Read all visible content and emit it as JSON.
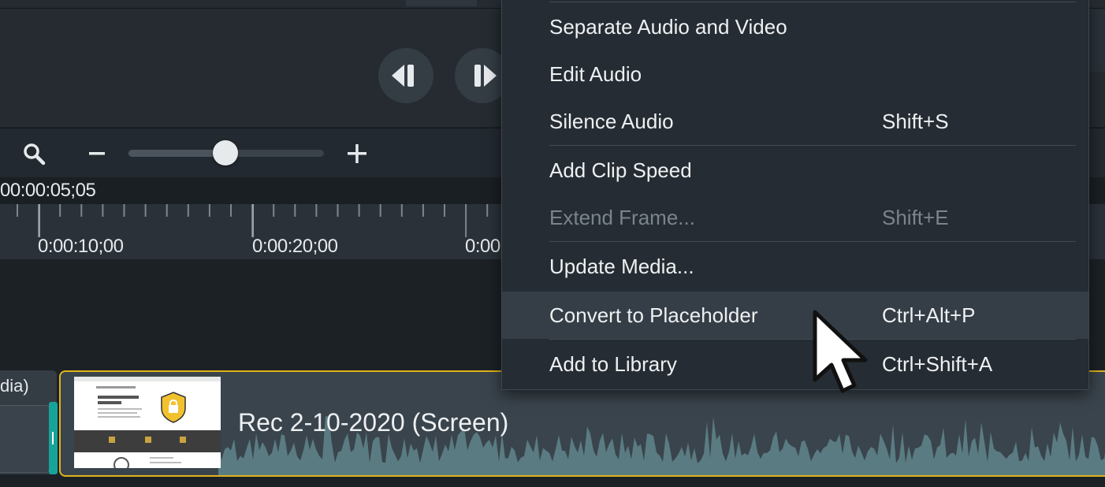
{
  "playhead": {
    "time": "00:00:05;05"
  },
  "ruler": {
    "labels": [
      "0:00:10;00",
      "0:00:20;00",
      "0:00"
    ]
  },
  "zoom": {
    "minus_symbol": "−",
    "plus_symbol": "+",
    "level": 0.5
  },
  "tracks": {
    "left_clip_label": "dia)",
    "main_clip_title": "Rec 2-10-2020 (Screen)"
  },
  "context_menu": {
    "items": [
      {
        "label": "Separate Audio and Video",
        "shortcut": "",
        "enabled": true,
        "highlighted": false
      },
      {
        "label": "Edit Audio",
        "shortcut": "",
        "enabled": true,
        "highlighted": false
      },
      {
        "label": "Silence Audio",
        "shortcut": "Shift+S",
        "enabled": true,
        "highlighted": false
      },
      {
        "label": "Add Clip Speed",
        "shortcut": "",
        "enabled": true,
        "highlighted": false
      },
      {
        "label": "Extend Frame...",
        "shortcut": "Shift+E",
        "enabled": false,
        "highlighted": false
      },
      {
        "label": "Update Media...",
        "shortcut": "",
        "enabled": true,
        "highlighted": false
      },
      {
        "label": "Convert to Placeholder",
        "shortcut": "Ctrl+Alt+P",
        "enabled": true,
        "highlighted": true
      },
      {
        "label": "Add to Library",
        "shortcut": "Ctrl+Shift+A",
        "enabled": true,
        "highlighted": false
      }
    ]
  },
  "icons": {
    "prev": "step-back-icon",
    "next": "step-forward-icon",
    "search": "search-icon",
    "cursor": "mouse-pointer-icon"
  },
  "colors": {
    "clip_border": "#e0b31c",
    "teal_handle": "#16a39a",
    "thumbnail_badge": "#f2c12e"
  }
}
